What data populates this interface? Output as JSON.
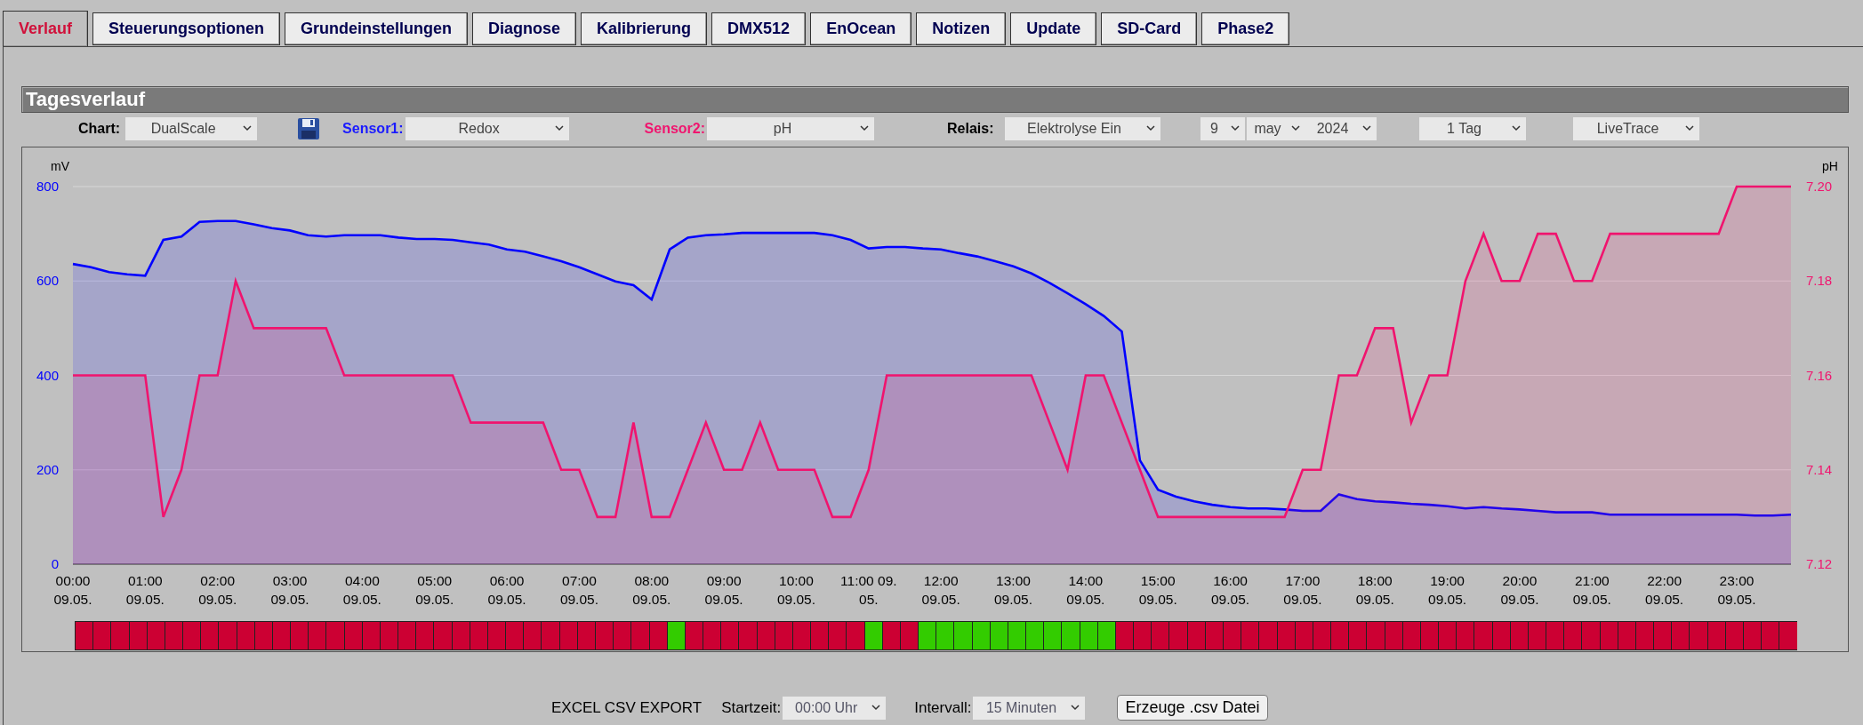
{
  "tabs": [
    {
      "label": "Verlauf",
      "selected": true
    },
    {
      "label": "Steuerungsoptionen",
      "selected": false
    },
    {
      "label": "Grundeinstellungen",
      "selected": false
    },
    {
      "label": "Diagnose",
      "selected": false
    },
    {
      "label": "Kalibrierung",
      "selected": false
    },
    {
      "label": "DMX512",
      "selected": false
    },
    {
      "label": "EnOcean",
      "selected": false
    },
    {
      "label": "Notizen",
      "selected": false
    },
    {
      "label": "Update",
      "selected": false
    },
    {
      "label": "SD-Card",
      "selected": false
    },
    {
      "label": "Phase2",
      "selected": false
    }
  ],
  "section_title": "Tagesverlauf",
  "toolbar": {
    "chart": {
      "label": "Chart:",
      "value": "DualScale"
    },
    "sensor1": {
      "label": "Sensor1:",
      "value": "Redox"
    },
    "sensor2": {
      "label": "Sensor2:",
      "value": "pH"
    },
    "relais": {
      "label": "Relais:",
      "value": "Elektrolyse Ein"
    },
    "day": "9",
    "month": "may",
    "year": "2024",
    "range": "1 Tag",
    "mode": "LiveTrace"
  },
  "chart": {
    "redox": {
      "chart_data": {
        "type": "area",
        "ylabel": "mV",
        "xlim": [
          0,
          23.75
        ],
        "ylim": [
          0,
          800
        ],
        "yticks": [
          {
            "value": 800,
            "label": "800"
          },
          {
            "value": 600,
            "label": "600"
          },
          {
            "value": 400,
            "label": "400"
          },
          {
            "value": 200,
            "label": "200"
          },
          {
            "value": 0,
            "label": "0"
          }
        ],
        "xticks": [
          {
            "value": 0,
            "label": "00:00"
          },
          {
            "value": 1,
            "label": "01:00"
          },
          {
            "value": 2,
            "label": "02:00"
          },
          {
            "value": 3,
            "label": "03:00"
          },
          {
            "value": 4,
            "label": "04:00"
          },
          {
            "value": 5,
            "label": "05:00"
          },
          {
            "value": 6,
            "label": "06:00"
          },
          {
            "value": 7,
            "label": "07:00"
          },
          {
            "value": 8,
            "label": "08:00"
          },
          {
            "value": 9,
            "label": "09:00"
          },
          {
            "value": 10,
            "label": "10:00"
          },
          {
            "value": 11,
            "label": "11:00 09."
          },
          {
            "value": 12,
            "label": "12:00"
          },
          {
            "value": 13,
            "label": "13:00"
          },
          {
            "value": 14,
            "label": "14:00"
          },
          {
            "value": 15,
            "label": "15:00"
          },
          {
            "value": 16,
            "label": "16:00"
          },
          {
            "value": 17,
            "label": "17:00"
          },
          {
            "value": 18,
            "label": "18:00"
          },
          {
            "value": 19,
            "label": "19:00"
          },
          {
            "value": 20,
            "label": "20:00"
          },
          {
            "value": 21,
            "label": "21:00"
          },
          {
            "value": 22,
            "label": "22:00"
          },
          {
            "value": 23,
            "label": "23:00"
          }
        ],
        "x": [
          0,
          0.25,
          0.5,
          0.75,
          1,
          1.25,
          1.5,
          1.75,
          2,
          2.25,
          2.5,
          2.75,
          3,
          3.25,
          3.5,
          3.75,
          4,
          4.25,
          4.5,
          4.75,
          5,
          5.25,
          5.5,
          5.75,
          6,
          6.25,
          6.5,
          6.75,
          7,
          7.25,
          7.5,
          7.75,
          8,
          8.25,
          8.5,
          8.75,
          9,
          9.25,
          9.5,
          9.75,
          10,
          10.25,
          10.5,
          10.75,
          11,
          11.25,
          11.5,
          11.75,
          12,
          12.25,
          12.5,
          12.75,
          13,
          13.25,
          13.5,
          13.75,
          14,
          14.25,
          14.5,
          14.75,
          15,
          15.25,
          15.5,
          15.75,
          16,
          16.25,
          16.5,
          16.75,
          17,
          17.25,
          17.5,
          17.75,
          18,
          18.25,
          18.5,
          18.75,
          19,
          19.25,
          19.5,
          19.75,
          20,
          20.25,
          20.5,
          20.75,
          21,
          21.25,
          21.5,
          21.75,
          22,
          22.25,
          22.5,
          22.75,
          23,
          23.25,
          23.5,
          23.75
        ],
        "series": [
          {
            "color": "#0000ff",
            "values": [
              636,
              629,
              619,
              614,
              611,
              687,
              694,
              725,
              727,
              727,
              720,
              712,
              707,
              697,
              694,
              697,
              697,
              697,
              692,
              689,
              689,
              687,
              682,
              677,
              667,
              662,
              652,
              642,
              629,
              614,
              599,
              591,
              561,
              667,
              692,
              697,
              699,
              702,
              702,
              702,
              702,
              702,
              697,
              687,
              669,
              672,
              672,
              669,
              667,
              659,
              652,
              642,
              631,
              616,
              596,
              574,
              551,
              526,
              493,
              220,
              158,
              143,
              133,
              126,
              121,
              118,
              118,
              116,
              113,
              113,
              148,
              138,
              133,
              131,
              128,
              126,
              123,
              118,
              121,
              118,
              116,
              113,
              110,
              110,
              110,
              105,
              105,
              105,
              105,
              105,
              105,
              105,
              105,
              103,
              103,
              105
            ]
          }
        ]
      }
    },
    "ph": {
      "chart_data": {
        "type": "area",
        "ylabel": "pH",
        "xlim": [
          0,
          23.75
        ],
        "ylim": [
          7.12,
          7.2
        ],
        "yticks": [
          {
            "value": 7.2,
            "label": "7.20"
          },
          {
            "value": 7.18,
            "label": "7.18"
          },
          {
            "value": 7.16,
            "label": "7.16"
          },
          {
            "value": 7.14,
            "label": "7.14"
          },
          {
            "value": 7.12,
            "label": "7.12"
          }
        ],
        "x": [
          0,
          0.25,
          0.5,
          0.75,
          1,
          1.25,
          1.5,
          1.75,
          2,
          2.25,
          2.5,
          2.75,
          3,
          3.25,
          3.5,
          3.75,
          4,
          4.25,
          4.5,
          4.75,
          5,
          5.25,
          5.5,
          5.75,
          6,
          6.25,
          6.5,
          6.75,
          7,
          7.25,
          7.5,
          7.75,
          8,
          8.25,
          8.5,
          8.75,
          9,
          9.25,
          9.5,
          9.75,
          10,
          10.25,
          10.5,
          10.75,
          11,
          11.25,
          11.5,
          11.75,
          12,
          12.25,
          12.5,
          12.75,
          13,
          13.25,
          13.5,
          13.75,
          14,
          14.25,
          14.5,
          14.75,
          15,
          15.25,
          15.5,
          15.75,
          16,
          16.25,
          16.5,
          16.75,
          17,
          17.25,
          17.5,
          17.75,
          18,
          18.25,
          18.5,
          18.75,
          19,
          19.25,
          19.5,
          19.75,
          20,
          20.25,
          20.5,
          20.75,
          21,
          21.25,
          21.5,
          21.75,
          22,
          22.25,
          22.5,
          22.75,
          23,
          23.25,
          23.5,
          23.75
        ],
        "series": [
          {
            "color": "#f0146e",
            "values": [
              7.16,
              7.16,
              7.16,
              7.16,
              7.16,
              7.13,
              7.14,
              7.16,
              7.16,
              7.18,
              7.17,
              7.17,
              7.17,
              7.17,
              7.17,
              7.16,
              7.16,
              7.16,
              7.16,
              7.16,
              7.16,
              7.16,
              7.15,
              7.15,
              7.15,
              7.15,
              7.15,
              7.14,
              7.14,
              7.13,
              7.13,
              7.15,
              7.13,
              7.13,
              7.14,
              7.15,
              7.14,
              7.14,
              7.15,
              7.14,
              7.14,
              7.14,
              7.13,
              7.13,
              7.14,
              7.16,
              7.16,
              7.16,
              7.16,
              7.16,
              7.16,
              7.16,
              7.16,
              7.16,
              7.15,
              7.14,
              7.16,
              7.16,
              7.15,
              7.14,
              7.13,
              7.13,
              7.13,
              7.13,
              7.13,
              7.13,
              7.13,
              7.13,
              7.14,
              7.14,
              7.16,
              7.16,
              7.17,
              7.17,
              7.15,
              7.16,
              7.16,
              7.18,
              7.19,
              7.18,
              7.18,
              7.19,
              7.19,
              7.18,
              7.18,
              7.19,
              7.19,
              7.19,
              7.19,
              7.19,
              7.19,
              7.19,
              7.2,
              7.2,
              7.2,
              7.2
            ]
          }
        ]
      }
    },
    "x_dates": [
      "09.05.",
      "09.05.",
      "09.05.",
      "09.05.",
      "09.05.",
      "09.05.",
      "09.05.",
      "09.05.",
      "09.05.",
      "09.05.",
      "09.05.",
      "05.",
      "09.05.",
      "09.05.",
      "09.05.",
      "09.05.",
      "09.05.",
      "09.05.",
      "09.05.",
      "09.05.",
      "09.05.",
      "09.05.",
      "09.05.",
      "09.05."
    ],
    "relay_strip": [
      {
        "on": false
      },
      {
        "on": false
      },
      {
        "on": false
      },
      {
        "on": false
      },
      {
        "on": false
      },
      {
        "on": false
      },
      {
        "on": false
      },
      {
        "on": false
      },
      {
        "on": false
      },
      {
        "on": false
      },
      {
        "on": false
      },
      {
        "on": false
      },
      {
        "on": false
      },
      {
        "on": false
      },
      {
        "on": false
      },
      {
        "on": false
      },
      {
        "on": false
      },
      {
        "on": false
      },
      {
        "on": false
      },
      {
        "on": false
      },
      {
        "on": false
      },
      {
        "on": false
      },
      {
        "on": false
      },
      {
        "on": false
      },
      {
        "on": false
      },
      {
        "on": false
      },
      {
        "on": false
      },
      {
        "on": false
      },
      {
        "on": false
      },
      {
        "on": false
      },
      {
        "on": false
      },
      {
        "on": false
      },
      {
        "on": false
      },
      {
        "on": true
      },
      {
        "on": false
      },
      {
        "on": false
      },
      {
        "on": false
      },
      {
        "on": false
      },
      {
        "on": false
      },
      {
        "on": false
      },
      {
        "on": false
      },
      {
        "on": false
      },
      {
        "on": false
      },
      {
        "on": false
      },
      {
        "on": true
      },
      {
        "on": false
      },
      {
        "on": false
      },
      {
        "on": true
      },
      {
        "on": true
      },
      {
        "on": true
      },
      {
        "on": true
      },
      {
        "on": true
      },
      {
        "on": true
      },
      {
        "on": true
      },
      {
        "on": true
      },
      {
        "on": true
      },
      {
        "on": true
      },
      {
        "on": true
      },
      {
        "on": false
      },
      {
        "on": false
      },
      {
        "on": false
      },
      {
        "on": false
      },
      {
        "on": false
      },
      {
        "on": false
      },
      {
        "on": false
      },
      {
        "on": false
      },
      {
        "on": false
      },
      {
        "on": false
      },
      {
        "on": false
      },
      {
        "on": false
      },
      {
        "on": false
      },
      {
        "on": false
      },
      {
        "on": false
      },
      {
        "on": false
      },
      {
        "on": false
      },
      {
        "on": false
      },
      {
        "on": false
      },
      {
        "on": false
      },
      {
        "on": false
      },
      {
        "on": false
      },
      {
        "on": false
      },
      {
        "on": false
      },
      {
        "on": false
      },
      {
        "on": false
      },
      {
        "on": false
      },
      {
        "on": false
      },
      {
        "on": false
      },
      {
        "on": false
      },
      {
        "on": false
      },
      {
        "on": false
      },
      {
        "on": false
      },
      {
        "on": false
      },
      {
        "on": false
      },
      {
        "on": false
      },
      {
        "on": false
      },
      {
        "on": false
      }
    ]
  },
  "export": {
    "title": "EXCEL CSV EXPORT",
    "start_label": "Startzeit:",
    "start_value": "00:00 Uhr",
    "interval_label": "Intervall:",
    "interval_value": "15 Minuten",
    "button": "Erzeuge .csv Datei"
  }
}
